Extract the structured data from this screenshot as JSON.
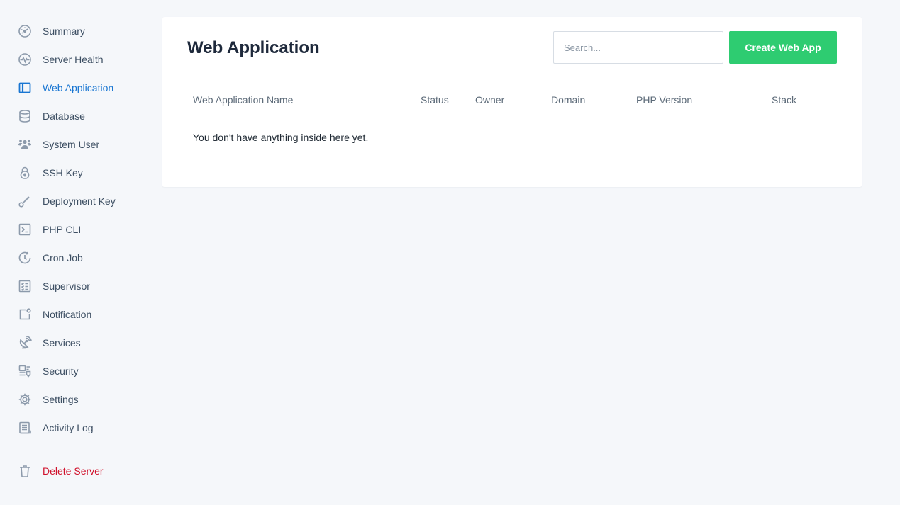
{
  "sidebar": {
    "items": [
      {
        "label": "Summary",
        "icon": "gauge-icon"
      },
      {
        "label": "Server Health",
        "icon": "pulse-icon"
      },
      {
        "label": "Web Application",
        "icon": "window-icon",
        "active": true
      },
      {
        "label": "Database",
        "icon": "database-icon"
      },
      {
        "label": "System User",
        "icon": "users-icon"
      },
      {
        "label": "SSH Key",
        "icon": "lock-icon"
      },
      {
        "label": "Deployment Key",
        "icon": "key-icon"
      },
      {
        "label": "PHP CLI",
        "icon": "terminal-icon"
      },
      {
        "label": "Cron Job",
        "icon": "clock-icon"
      },
      {
        "label": "Supervisor",
        "icon": "checklist-icon"
      },
      {
        "label": "Notification",
        "icon": "notification-icon"
      },
      {
        "label": "Services",
        "icon": "satellite-icon"
      },
      {
        "label": "Security",
        "icon": "shield-grid-icon"
      },
      {
        "label": "Settings",
        "icon": "gear-icon"
      },
      {
        "label": "Activity Log",
        "icon": "log-icon"
      }
    ],
    "delete_label": "Delete Server",
    "delete_icon": "trash-icon"
  },
  "main": {
    "title": "Web Application",
    "search_placeholder": "Search...",
    "create_label": "Create Web App",
    "columns": [
      "Web Application Name",
      "Status",
      "Owner",
      "Domain",
      "PHP Version",
      "Stack"
    ],
    "empty_message": "You don't have anything inside here yet."
  },
  "colors": {
    "accent": "#1976d2",
    "success": "#2ecc71",
    "danger": "#d0112b",
    "icon": "#8c9aab"
  }
}
